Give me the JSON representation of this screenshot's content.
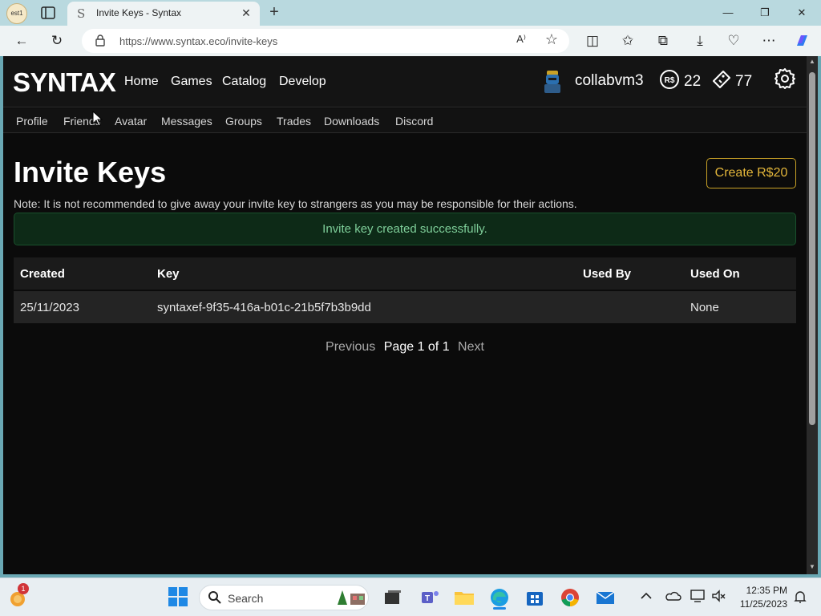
{
  "browser": {
    "profile_label": "est1",
    "tab_title": "Invite Keys - Syntax",
    "url": "https://www.syntax.eco/invite-keys"
  },
  "site": {
    "logo": "SYNTAX",
    "nav": [
      "Home",
      "Games",
      "Catalog",
      "Develop"
    ],
    "username": "collabvm3",
    "robux": "22",
    "tix": "77",
    "subnav": [
      "Profile",
      "Friends",
      "Avatar",
      "Messages",
      "Groups",
      "Trades",
      "Downloads",
      "Discord"
    ]
  },
  "page": {
    "title": "Invite Keys",
    "create_button": "Create R$20",
    "note": "Note: It is not recommended to give away your invite key to strangers as you may be responsible for their actions.",
    "alert": "Invite key created successfully.",
    "table": {
      "headers": [
        "Created",
        "Key",
        "Used By",
        "Used On"
      ],
      "rows": [
        [
          "25/11/2023",
          "syntaxef-9f35-416a-b01c-21b5f7b3b9dd",
          "",
          "None"
        ]
      ]
    },
    "pagination": {
      "previous": "Previous",
      "page_indicator": "Page 1 of 1",
      "next": "Next"
    }
  },
  "taskbar": {
    "search_placeholder": "Search",
    "time": "12:35 PM",
    "date": "11/25/2023",
    "notification_count": "1"
  },
  "colors": {
    "accent_gold": "#e3b63a",
    "success_text": "#7fcf9a",
    "page_bg": "#0b0b0b"
  }
}
